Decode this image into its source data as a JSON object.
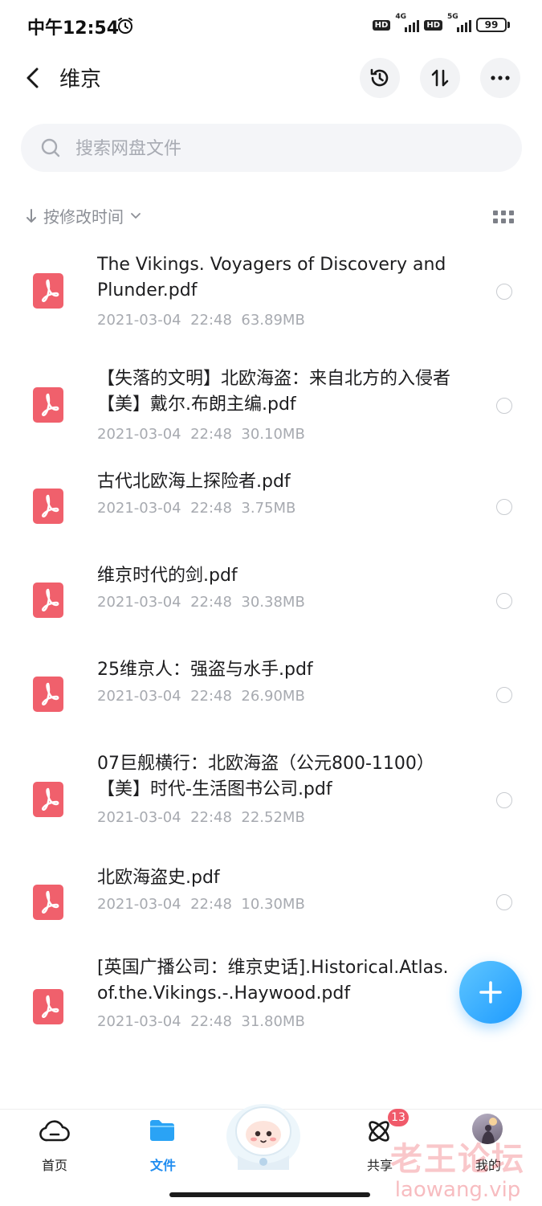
{
  "status_bar": {
    "time": "中午12:54",
    "net1": "4G",
    "net2": "5G",
    "hd": "HD",
    "battery": "99"
  },
  "header": {
    "title": "维京"
  },
  "search": {
    "placeholder": "搜索网盘文件"
  },
  "sort": {
    "label": "按修改时间"
  },
  "files": [
    {
      "name": "The Vikings. Voyagers of Discovery and Plunder.pdf",
      "date": "2021-03-04",
      "time": "22:48",
      "size": "63.89MB"
    },
    {
      "name": "【失落的文明】北欧海盗：来自北方的入侵者【美】戴尔.布朗主编.pdf",
      "date": "2021-03-04",
      "time": "22:48",
      "size": "30.10MB"
    },
    {
      "name": "古代北欧海上探险者.pdf",
      "date": "2021-03-04",
      "time": "22:48",
      "size": "3.75MB"
    },
    {
      "name": "维京时代的剑.pdf",
      "date": "2021-03-04",
      "time": "22:48",
      "size": "30.38MB"
    },
    {
      "name": "25维京人：强盗与水手.pdf",
      "date": "2021-03-04",
      "time": "22:48",
      "size": "26.90MB"
    },
    {
      "name": "07巨舰横行：北欧海盗（公元800-1100）【美】时代-生活图书公司.pdf",
      "date": "2021-03-04",
      "time": "22:48",
      "size": "22.52MB"
    },
    {
      "name": "北欧海盗史.pdf",
      "date": "2021-03-04",
      "time": "22:48",
      "size": "10.30MB"
    },
    {
      "name": "[英国广播公司：维京史话].Historical.Atlas.of.the.Vikings.-.Haywood.pdf",
      "date": "2021-03-04",
      "time": "22:48",
      "size": "31.80MB"
    }
  ],
  "bottom_nav": {
    "home": "首页",
    "files": "文件",
    "share": "共享",
    "share_badge": "13",
    "mine": "我的"
  },
  "watermark": {
    "line1": "老王论坛",
    "line2": "laowang.vip"
  },
  "colors": {
    "accent": "#1e8cf0",
    "pdf_red": "#f0606c",
    "badge": "#f05a6a"
  }
}
